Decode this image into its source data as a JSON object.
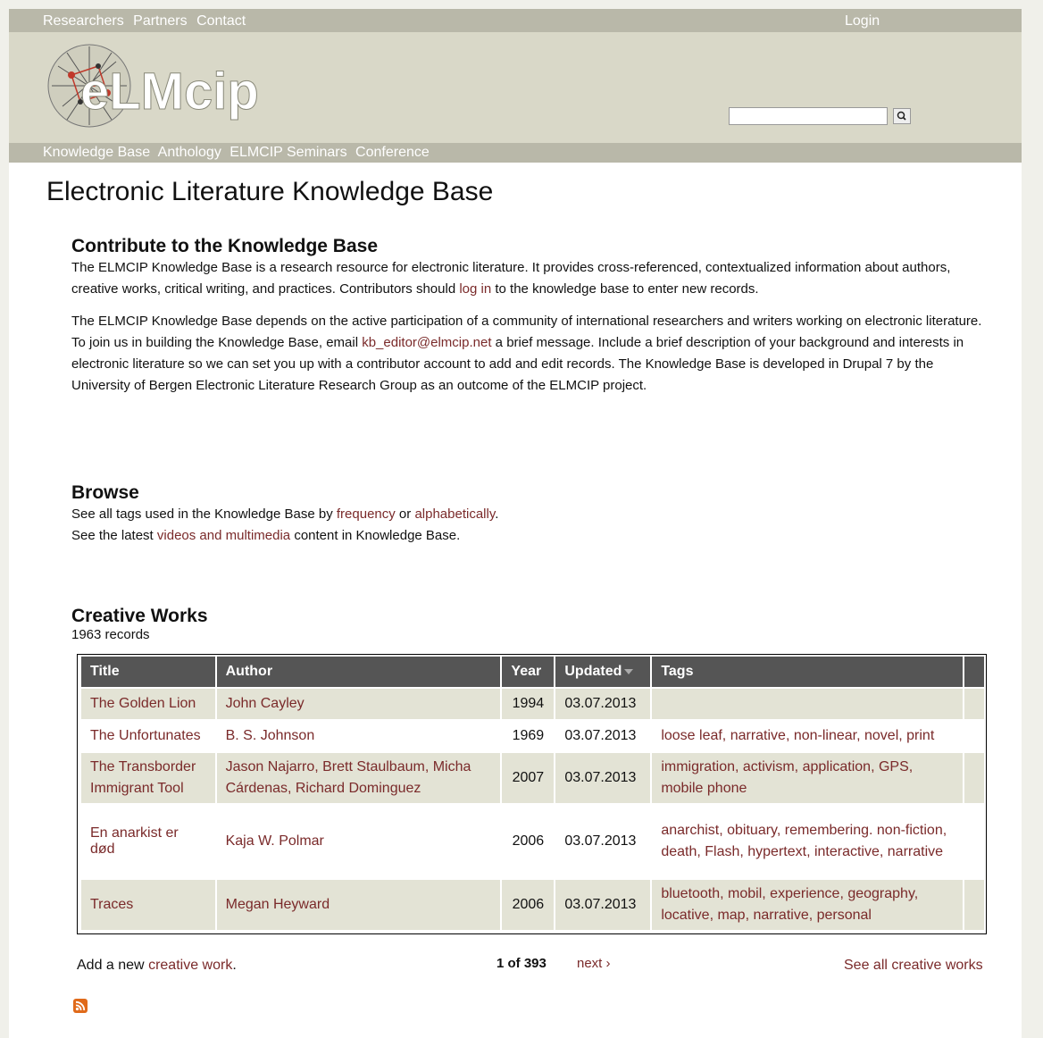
{
  "topnav": {
    "items": [
      "Researchers",
      "Partners",
      "Contact"
    ],
    "login": "Login"
  },
  "subnav": {
    "items": [
      "Knowledge Base",
      "Anthology",
      "ELMCIP Seminars",
      "Conference"
    ]
  },
  "logo": {
    "text": "eLMcip"
  },
  "search": {
    "value": "",
    "placeholder": ""
  },
  "page_title": "Electronic Literature Knowledge Base",
  "contribute": {
    "heading": "Contribute to the Knowledge Base",
    "p1_a": "The ELMCIP Knowledge Base is a research resource for electronic literature. It provides cross-referenced, contextualized information about authors, creative works, critical writing, and practices. Contributors should ",
    "p1_link": "log in",
    "p1_b": " to the knowledge base to enter new records.",
    "p2_a": "The ELMCIP Knowledge Base depends on the active participation of a community of international researchers and writers working on electronic literature. To join us in building the Knowledge Base, email ",
    "p2_link": "kb_editor@elmcip.net",
    "p2_b": " a brief message. Include a brief description of your background and interests in electronic literature so we can set you up with a contributor account to add and edit records. The Knowledge Base is developed in Drupal 7 by the University of Bergen Electronic Literature Research Group as an outcome of the ELMCIP project."
  },
  "browse": {
    "heading": "Browse",
    "l1_a": "See all tags used in the Knowledge Base by ",
    "l1_link1": "frequency",
    "l1_mid": " or ",
    "l1_link2": "alphabetically",
    "l1_end": ".",
    "l2_a": "See the latest ",
    "l2_link": "videos and multimedia",
    "l2_b": " content in Knowledge Base."
  },
  "creative_works": {
    "heading": "Creative Works",
    "count": "1963 records",
    "columns": [
      "Title",
      "Author",
      "Year",
      "Updated",
      "Tags"
    ],
    "rows": [
      {
        "title": "The Golden Lion",
        "author": "John Cayley",
        "year": "1994",
        "updated": "03.07.2013",
        "tags": ""
      },
      {
        "title": "The Unfortunates",
        "author": "B. S. Johnson",
        "year": "1969",
        "updated": "03.07.2013",
        "tags": "loose leaf, narrative, non-linear, novel, print"
      },
      {
        "title": "The Transborder Immigrant Tool",
        "author": "Jason Najarro, Brett Staulbaum, Micha Cárdenas, Richard Dominguez",
        "year": "2007",
        "updated": "03.07.2013",
        "tags": "immigration, activism, application, GPS, mobile phone"
      },
      {
        "title": "En anarkist er død",
        "author": "Kaja W. Polmar",
        "year": "2006",
        "updated": "03.07.2013",
        "tags": "anarchist, obituary, remembering. non-fiction, death, Flash, hypertext, interactive, narrative"
      },
      {
        "title": "Traces",
        "author": "Megan Heyward",
        "year": "2006",
        "updated": "03.07.2013",
        "tags": "bluetooth, mobil, experience, geography, locative, map, narrative, personal"
      }
    ],
    "add_a": "Add a new ",
    "add_link": "creative work",
    "add_end": ".",
    "pager_current": "1 of 393",
    "pager_next": "next ›",
    "see_all": "See all creative works"
  },
  "colors": {
    "link": "#7a2a2a",
    "bar": "#b9b8a9",
    "header": "#d9d8c8",
    "row_alt": "#e3e3d5",
    "table_head": "#555555"
  }
}
